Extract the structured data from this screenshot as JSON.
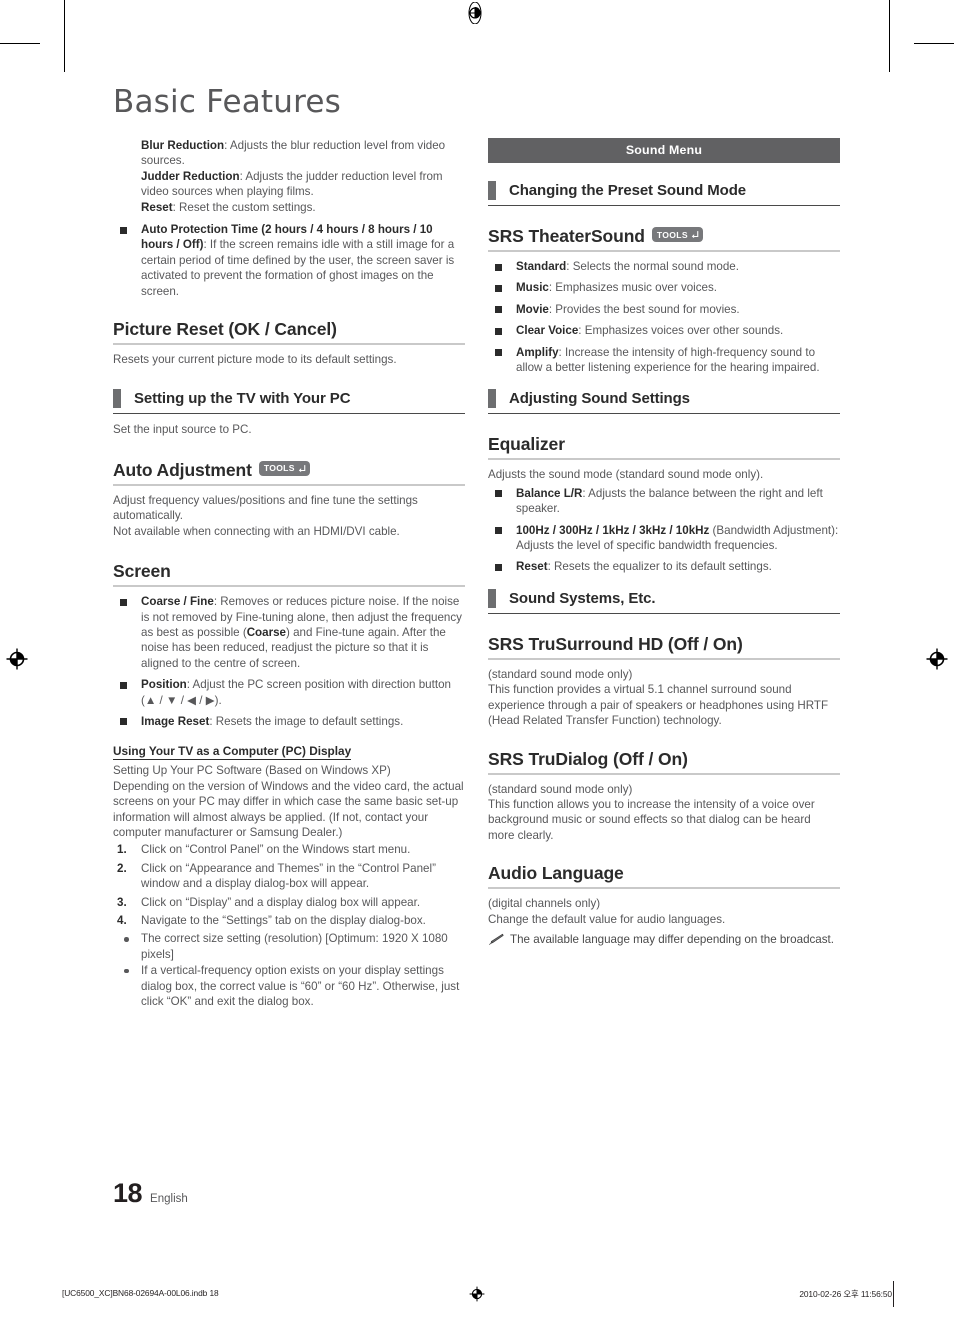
{
  "page": {
    "title": "Basic Features",
    "folio_number": "18",
    "folio_language": "English",
    "footer_left": "[UC6500_XC]BN68-02694A-00L06.indb   18",
    "footer_right": "2010-02-26   오후 11:56:50"
  },
  "colors": {
    "body_text": "#58585a",
    "bold_text": "#2b2b2b",
    "menu_band": "#616163",
    "heading_rule": "#c9c9c9",
    "bar_tab": "#6d6e70",
    "tools_badge": "#77787b"
  },
  "icons": {
    "tools_label": "TOOLS",
    "tools_arrow": "return-arrow-icon",
    "note_pencil": "pencil-icon",
    "registration": "registration-mark"
  },
  "left_column": {
    "lead_items": [
      {
        "term": "Blur Reduction",
        "text": ": Adjusts the blur reduction level from video sources."
      },
      {
        "term": "Judder Reduction",
        "text": ": Adjusts the judder reduction level from video sources when playing films."
      },
      {
        "term": "Reset",
        "text": ": Reset the custom settings."
      }
    ],
    "auto_protection": {
      "term": "Auto Protection Time (2 hours / 4 hours / 8 hours / 10 hours / Off)",
      "text": ":  If the screen remains idle with a still image for a certain period of time defined by the user, the screen saver is activated to prevent the formation of ghost images on the screen."
    },
    "picture_reset": {
      "heading": "Picture Reset (OK / Cancel)",
      "body": "Resets your current picture mode to its default settings."
    },
    "setting_up_pc": {
      "heading": "Setting up the TV with Your PC",
      "body": "Set the input source to PC."
    },
    "auto_adjustment": {
      "heading": "Auto Adjustment",
      "has_tools": true,
      "body1": "Adjust frequency values/positions and fine tune the settings automatically.",
      "body2": "Not available when connecting with an HDMI/DVI cable."
    },
    "screen": {
      "heading": "Screen",
      "items": [
        {
          "term": "Coarse / Fine",
          "text": ": Removes or reduces picture noise. If the noise is not removed by Fine-tuning alone, then adjust the frequency as best as possible (",
          "term2": "Coarse",
          "text2": ") and Fine-tune again. After the noise has been reduced, readjust the picture so that it is aligned to the centre of screen."
        },
        {
          "term": "Position",
          "text": ": Adjust the PC screen position with direction button (▲ / ▼ / ◀ / ▶)."
        },
        {
          "term": "Image Reset",
          "text": ": Resets the image to default settings."
        }
      ]
    },
    "pc_display": {
      "heading": "Using Your TV as a Computer (PC) Display",
      "line1": "Setting Up Your PC Software (Based on Windows XP)",
      "line2": "Depending on the version of Windows and the video card, the actual screens on your PC may differ in which case the same basic set-up information will almost always be applied. (If not, contact your computer manufacturer or Samsung Dealer.)",
      "steps": [
        "Click on “Control Panel” on the Windows start menu.",
        "Click on “Appearance and Themes” in the “Control Panel” window and a display dialog-box will appear.",
        "Click on “Display” and a display dialog box will appear.",
        "Navigate to the “Settings” tab on the display dialog-box."
      ],
      "notes": [
        "The correct size setting (resolution) [Optimum: 1920 X 1080 pixels]",
        "If a vertical-frequency option exists on your display settings dialog box, the correct value is “60” or “60 Hz”. Otherwise, just click “OK” and exit the dialog box."
      ]
    }
  },
  "right_column": {
    "menu_band": "Sound Menu",
    "changing_preset": {
      "heading": "Changing the Preset Sound Mode"
    },
    "theatersound": {
      "heading": "SRS TheaterSound",
      "has_tools": true,
      "items": [
        {
          "term": "Standard",
          "text": ": Selects the normal sound mode."
        },
        {
          "term": "Music",
          "text": ": Emphasizes music over voices."
        },
        {
          "term": "Movie",
          "text": ": Provides the best sound for movies."
        },
        {
          "term": "Clear Voice",
          "text": ": Emphasizes voices over other sounds."
        },
        {
          "term": "Amplify",
          "text": ": Increase the intensity of high-frequency sound to allow a better listening experience for the hearing impaired."
        }
      ]
    },
    "adjusting_sound": {
      "heading": "Adjusting Sound Settings"
    },
    "equalizer": {
      "heading": "Equalizer",
      "body": "Adjusts the sound mode (standard sound mode only).",
      "items": [
        {
          "term": "Balance L/R",
          "text": ": Adjusts the balance between the right and left speaker."
        },
        {
          "term": "100Hz / 300Hz / 1kHz / 3kHz / 10kHz",
          "text": " (Bandwidth Adjustment): Adjusts the level of specific bandwidth frequencies."
        },
        {
          "term": "Reset",
          "text": ": Resets the equalizer to its default settings."
        }
      ]
    },
    "sound_systems": {
      "heading": "Sound Systems, Etc."
    },
    "trusurround": {
      "heading": "SRS TruSurround HD (Off / On)",
      "sub": "(standard sound mode only)",
      "body": "This function provides a virtual 5.1 channel surround sound experience through a pair of speakers or headphones using HRTF (Head Related Transfer Function) technology."
    },
    "trudialog": {
      "heading": "SRS TruDialog (Off / On)",
      "sub": "(standard sound mode only)",
      "body": "This function allows you to increase the intensity of a voice over background music or sound effects so that dialog can be heard more clearly."
    },
    "audio_language": {
      "heading": "Audio Language",
      "sub": "(digital channels only)",
      "body": "Change the default value for audio languages.",
      "note": "The available language may differ depending on the broadcast."
    }
  }
}
